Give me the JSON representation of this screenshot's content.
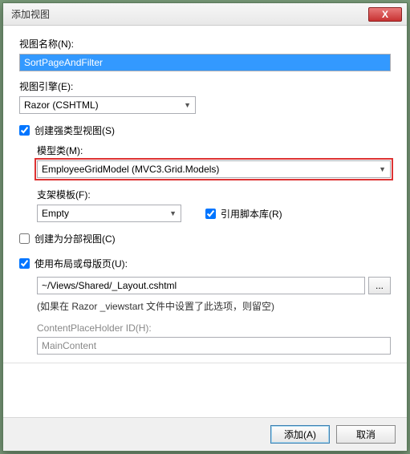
{
  "titlebar": {
    "title": "添加视图",
    "close": "X"
  },
  "viewName": {
    "label": "视图名称(N):",
    "value": "SortPageAndFilter"
  },
  "viewEngine": {
    "label": "视图引擎(E):",
    "value": "Razor (CSHTML)"
  },
  "stronglyTyped": {
    "label": "创建强类型视图(S)",
    "checked": true,
    "modelClass": {
      "label": "模型类(M):",
      "value": "EmployeeGridModel (MVC3.Grid.Models)"
    },
    "scaffold": {
      "label": "支架模板(F):",
      "value": "Empty"
    },
    "refScriptLib": {
      "label": "引用脚本库(R)",
      "checked": true
    }
  },
  "partial": {
    "label": "创建为分部视图(C)",
    "checked": false
  },
  "layout": {
    "label": "使用布局或母版页(U):",
    "checked": true,
    "path": "~/Views/Shared/_Layout.cshtml",
    "browse": "...",
    "hint": "(如果在 Razor _viewstart 文件中设置了此选项，则留空)",
    "cph": {
      "label": "ContentPlaceHolder ID(H):",
      "value": "MainContent"
    }
  },
  "buttons": {
    "add": "添加(A)",
    "cancel": "取消"
  }
}
